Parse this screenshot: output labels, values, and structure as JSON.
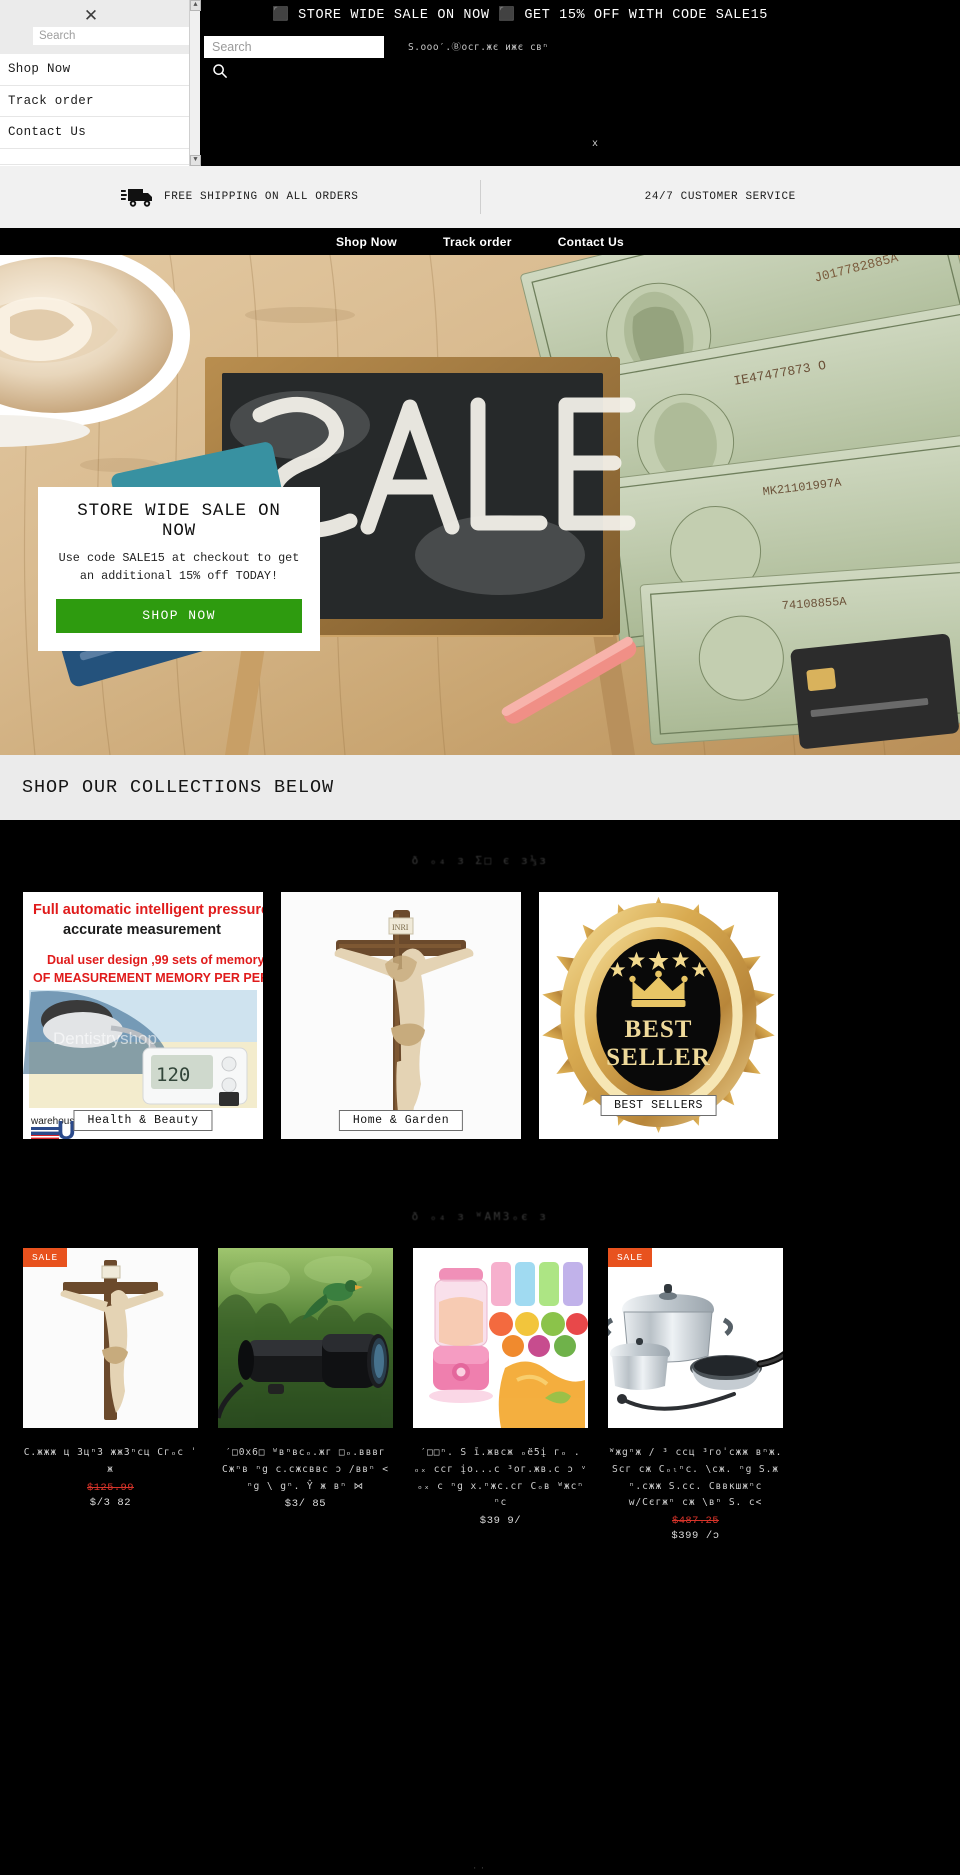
{
  "header": {
    "announcement": "⬛ STORE WIDE SALE ON NOW ⬛ GET 15% OFF WITH CODE SALE15",
    "search_placeholder": "Search",
    "search_value": "",
    "brand_ghost": "S.ooo′.Ⓑocг.жє ижє cвⁿ",
    "stray_x": "x"
  },
  "drawer": {
    "close_label": "✕",
    "search_placeholder": "Search",
    "search_value": "",
    "items": [
      {
        "label": "Shop Now"
      },
      {
        "label": "Track order"
      },
      {
        "label": "Contact Us"
      }
    ],
    "scroll_up": "▲",
    "scroll_down": "▼"
  },
  "feature_bar": {
    "items": [
      {
        "icon": "truck-icon",
        "label": "FREE SHIPPING ON ALL ORDERS"
      },
      {
        "icon": "none",
        "label": "24/7 CUSTOMER SERVICE"
      }
    ]
  },
  "main_nav": {
    "items": [
      {
        "label": "Shop Now"
      },
      {
        "label": "Track order"
      },
      {
        "label": "Contact Us"
      }
    ]
  },
  "hero": {
    "popup": {
      "title": "STORE WIDE SALE ON NOW",
      "subtitle": "Use code SALE15 at checkout to get an additional 15% off TODAY!",
      "button": "SHOP NOW"
    }
  },
  "collections_band": {
    "title": "SHOP OUR COLLECTIONS BELOW"
  },
  "collections": {
    "ghost_heading": "ð ₒ₄ з Σ□  є  з⅓з",
    "cards": [
      {
        "label": "Health & Beauty",
        "image": "blood-pressure-monitor-image"
      },
      {
        "label": "Home & Garden",
        "image": "crucifix-image"
      },
      {
        "label": "BEST SELLERS",
        "image": "best-seller-badge-image"
      }
    ]
  },
  "products": {
    "ghost_heading": "ð ₒ₄ з ᵂАМЗₒє з",
    "items": [
      {
        "badge": "SALE",
        "image": "crucifix-image",
        "title": "C.жжж ц ЗцⁿЗ жжЗⁿcц Cгₒc ˈ ж",
        "compare_at": "$125.99",
        "price": "$/3 82"
      },
      {
        "badge": "",
        "image": "binoculars-image",
        "title": "′□0x6□ ᵂвⁿвcₒ.жг □ₒ.вввг Cжⁿв ⁿg  c.cжcввc  ɔ /ввⁿ  < ⁿg \\ gⁿ. Ŷ ж вⁿ  ⋈",
        "compare_at": "",
        "price": "$3/ 85"
      },
      {
        "badge": "",
        "image": "portable-blender-image",
        "title": "′□□ⁿ. Ѕ ī.жвcж ₒё5į  гₒ .  ₒₓ ccг įo...c ³ог.жв.c ɔ ᵛ  ₒₓ c ⁿg  х.ⁿжc.cг Cₒв  ᵂжcⁿ ⁿc",
        "compare_at": "",
        "price": "$39 9/"
      },
      {
        "badge": "SALE",
        "image": "cookware-set-image",
        "title": "ᵂжgⁿж / ³ ccц ³гоˈcжж вⁿж. Scг cж Cₒₗⁿc. \\cж. ⁿg S.ж ⁿ.cжж S.cc. Cввкшжⁿc w/Cєгжⁿ cж \\вⁿ S. c<",
        "compare_at": "$487.25",
        "price": "$399 /ɔ"
      }
    ]
  },
  "footer_ghost": "∙∙"
}
